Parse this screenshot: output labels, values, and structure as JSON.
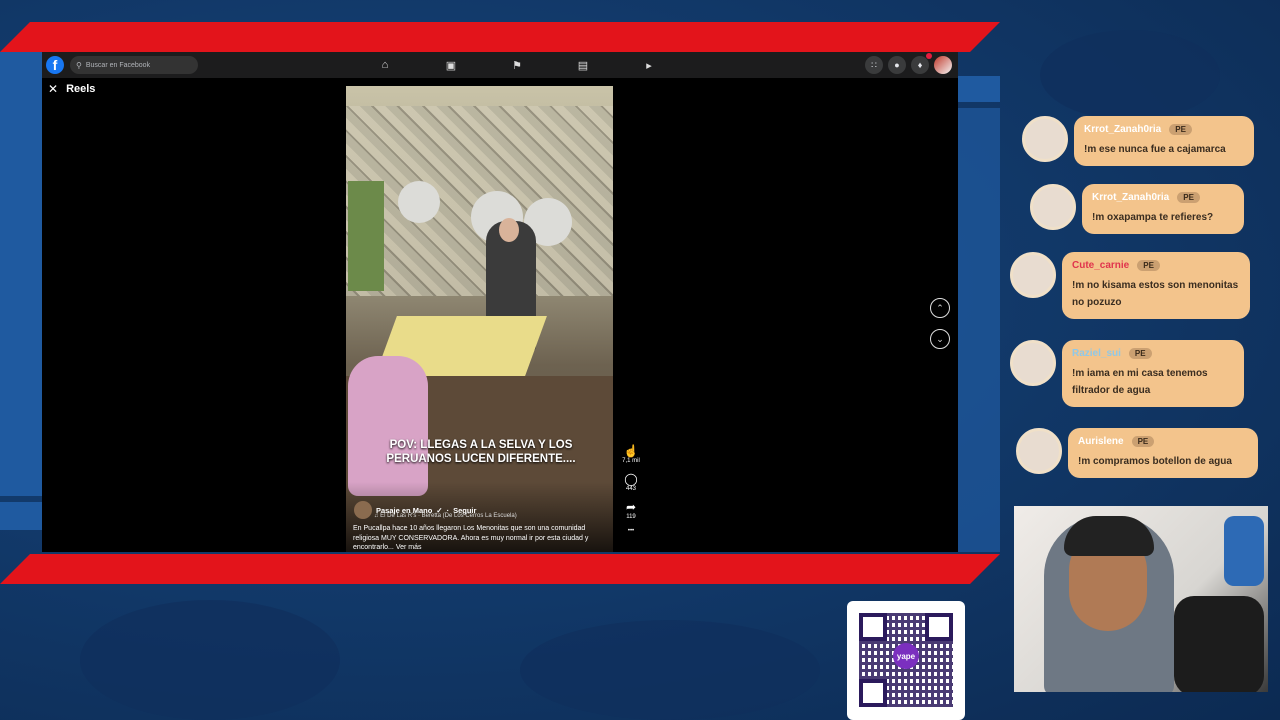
{
  "facebook": {
    "logo_letter": "f",
    "search_placeholder": "Buscar en Facebook",
    "nav_icons": [
      "home-icon",
      "video-icon",
      "flag-icon",
      "marketplace-icon",
      "megaphone-icon"
    ],
    "right_icons": [
      "apps-icon",
      "messenger-icon",
      "notifications-icon"
    ],
    "notification_count": "1"
  },
  "reels": {
    "title": "Reels",
    "overlay_text": "POV: LLEGAS A LA SELVA Y LOS PERUANOS LUCEN DIFERENTE....",
    "author": "Pasaje en Mano",
    "follow_label": "Seguir",
    "music": "El De Las R's · Beretta (De Los Cerros La Escuela)",
    "caption": "En Pucallpa hace 10 años llegaron Los Menonitas que son una comunidad religiosa MUY CONSERVADORA. Ahora es muy normal ir por esta ciudad y encontrarlo...",
    "see_more": "Ver más",
    "likes": "7,1 mil",
    "comments": "443",
    "shares": "119"
  },
  "chat": [
    {
      "name": "Krrot_Zanah0ria",
      "tag": "PE",
      "message": "!m ese nunca fue a cajamarca",
      "name_color": "#ffffff"
    },
    {
      "name": "Krrot_Zanah0ria",
      "tag": "PE",
      "message": "!m oxapampa te refieres?",
      "name_color": "#ffffff"
    },
    {
      "name": "Cute_carnie",
      "tag": "PE",
      "message": "!m no kisama estos son menonitas no pozuzo",
      "name_color": "#e0344d"
    },
    {
      "name": "Raziel_sui",
      "tag": "PE",
      "message": "!m iama en mi casa tenemos filtrador de agua",
      "name_color": "#8fc8e8"
    },
    {
      "name": "Aurislene",
      "tag": "PE",
      "message": "!m compramos botellon de agua",
      "name_color": "#ffffff"
    }
  ],
  "qr": {
    "brand": "yape"
  }
}
